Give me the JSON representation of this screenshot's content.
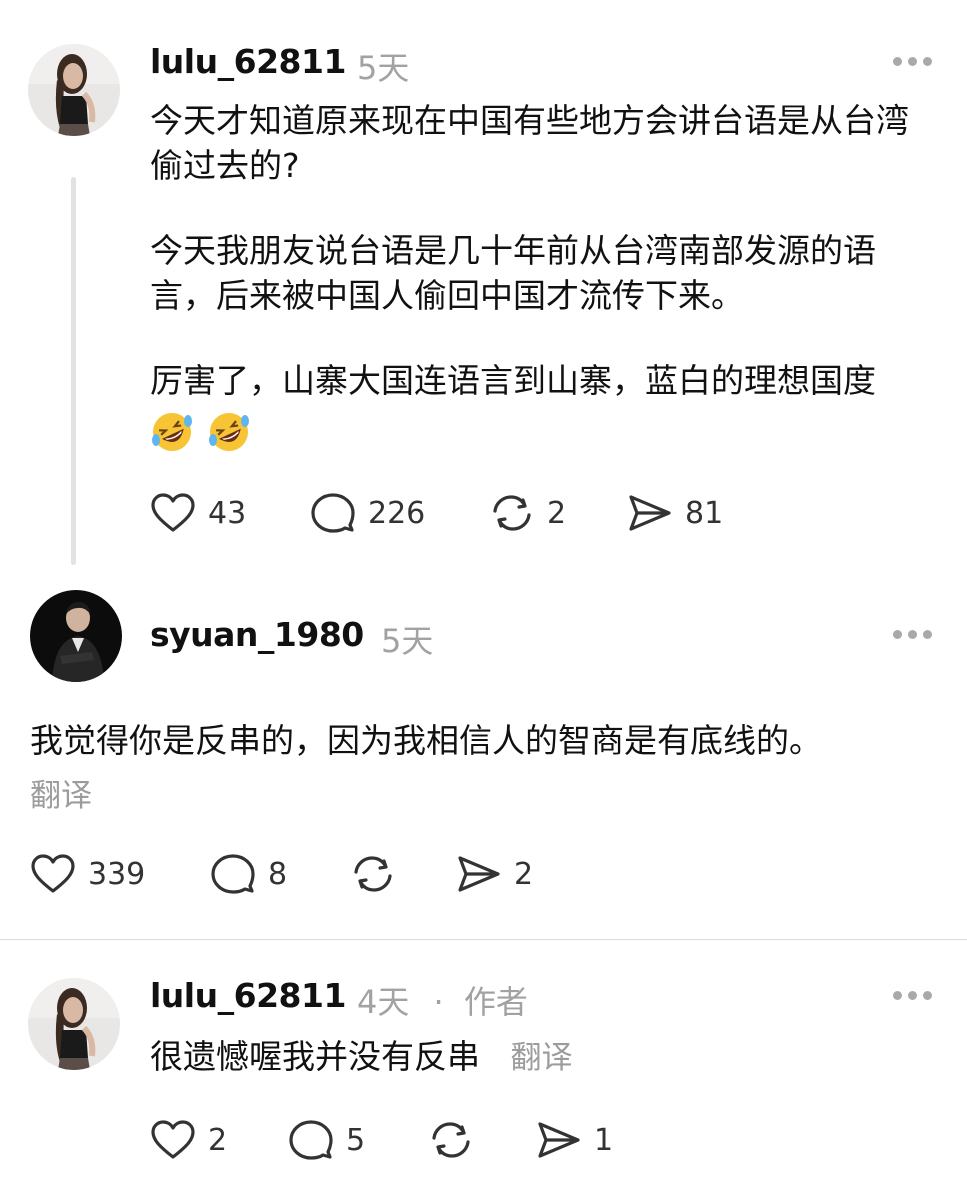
{
  "posts": [
    {
      "username": "lulu_62811",
      "time": "5天",
      "avatar_icon": "woman-portrait-avatar",
      "paragraphs": [
        "今天才知道原来现在中国有些地方会讲台语是从台湾偷过去的?",
        "今天我朋友说台语是几十年前从台湾南部发源的语言，后来被中国人偷回中国才流传下来。",
        "厉害了，山寨大国连语言到山寨，蓝白的理想国度"
      ],
      "emojis": [
        "🤣",
        "🤣"
      ],
      "likes": "43",
      "replies": "226",
      "reposts": "2",
      "shares": "81"
    },
    {
      "username": "syuan_1980",
      "time": "5天",
      "avatar_icon": "man-portrait-avatar",
      "text": "我觉得你是反串的，因为我相信人的智商是有底线的。",
      "translate": "翻译",
      "likes": "339",
      "replies": "8",
      "reposts": "",
      "shares": "2"
    },
    {
      "username": "lulu_62811",
      "time": "4天",
      "separator": "·",
      "author_tag": "作者",
      "avatar_icon": "woman-portrait-avatar",
      "text": "很遗憾喔我并没有反串",
      "translate": "翻译",
      "likes": "2",
      "replies": "5",
      "reposts": "",
      "shares": "1"
    }
  ],
  "colors": {
    "text": "#111111",
    "muted": "#a2a2a2",
    "icon": "#333333",
    "thread_line": "#e2e2e2"
  }
}
